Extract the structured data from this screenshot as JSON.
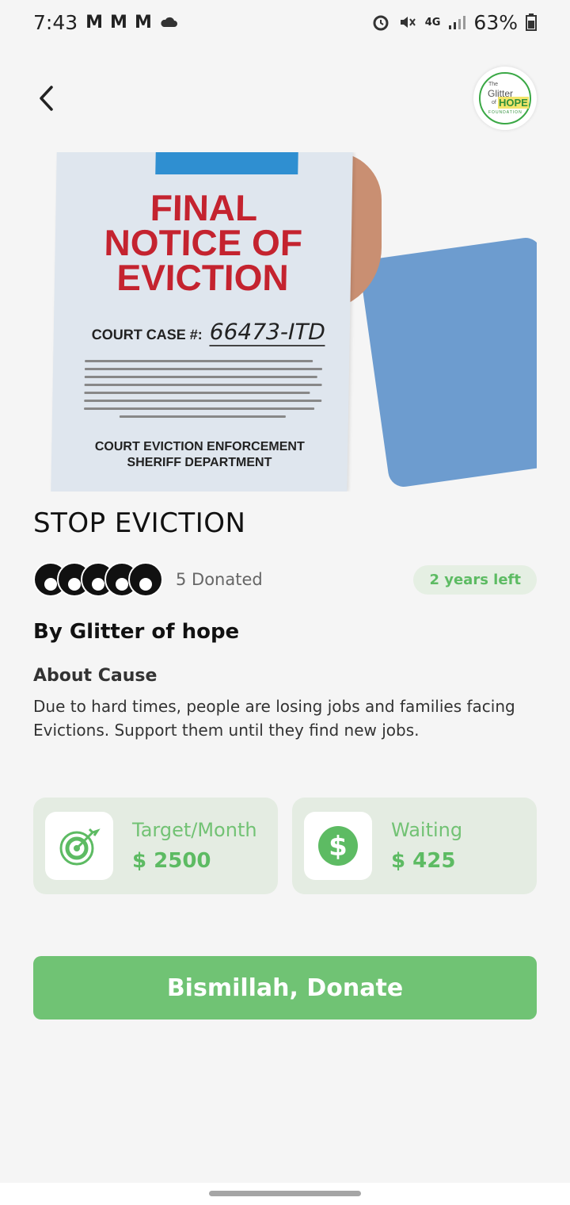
{
  "status_bar": {
    "time": "7:43",
    "mail_icons": [
      "M",
      "M",
      "M"
    ],
    "network": "4G",
    "battery": "63%"
  },
  "header": {
    "logo": {
      "the": "The",
      "glitter": "Glitter",
      "of": "of",
      "hope": "HOPE",
      "foundation": "FOUNDATION"
    }
  },
  "hero": {
    "notice_title": "FINAL\nNOTICE OF\nEVICTION",
    "court_case_label": "COURT CASE #:",
    "court_case_value": "66473-ITD",
    "footer": "COURT EVICTION ENFORCEMENT\nSHERIFF DEPARTMENT"
  },
  "cause": {
    "title": "STOP EVICTION",
    "donated": "5 Donated",
    "time_left": "2 years left",
    "by": "By Glitter of hope",
    "about_heading": "About Cause",
    "about_text": "Due to hard times, people are losing jobs and families facing\nEvictions.   Support them until they find new jobs."
  },
  "stats": {
    "target_label": "Target/Month",
    "target_value": "$ 2500",
    "waiting_label": "Waiting",
    "waiting_value": "$ 425"
  },
  "donate_button": "Bismillah, Donate",
  "colors": {
    "accent": "#70c374",
    "badge_bg": "#e5efe3",
    "card_bg": "#e4ece2",
    "notice_red": "#c4232f"
  }
}
